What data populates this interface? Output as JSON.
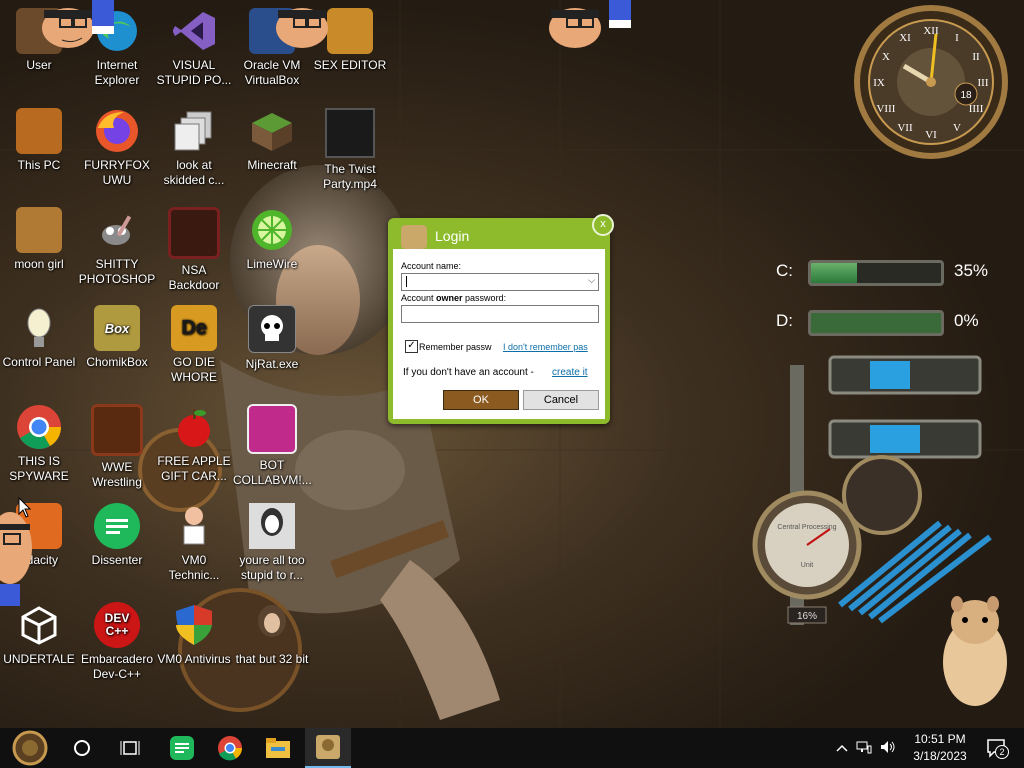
{
  "desktop_icons": [
    {
      "label": "User",
      "icon": "user-icon",
      "color": "#6a4a2a"
    },
    {
      "label": "Internet Explorer",
      "icon": "edge-icon",
      "color": "#1e8fcf"
    },
    {
      "label": "VISUAL STUPID PO...",
      "icon": "visual-studio-icon",
      "color": "#6b3fa0"
    },
    {
      "label": "Oracle VM VirtualBox",
      "icon": "virtualbox-icon",
      "color": "#2a4e8c"
    },
    {
      "label": "SEX EDITOR",
      "icon": "hex-editor-icon",
      "color": "#c98a2a"
    },
    {
      "label": "This PC",
      "icon": "this-pc-icon",
      "color": "#b86b20"
    },
    {
      "label": "FURRYFOX UWU",
      "icon": "firefox-icon",
      "color": "#e8562a"
    },
    {
      "label": "look at skidded c...",
      "icon": "files-icon",
      "color": "#9a9a9a"
    },
    {
      "label": "Minecraft",
      "icon": "minecraft-icon",
      "color": "#5b7a35"
    },
    {
      "label": "The Twist Party.mp4",
      "icon": "video-icon",
      "color": "#2a2a2a"
    },
    {
      "label": "moon girl",
      "icon": "folder-icon",
      "color": "#b07a35"
    },
    {
      "label": "SHITTY PHOTOSHOP",
      "icon": "gimp-icon",
      "color": "#777777"
    },
    {
      "label": "NSA Backdoor",
      "icon": "backdoor-icon",
      "color": "#7a2020"
    },
    {
      "label": "LimeWire",
      "icon": "limewire-icon",
      "color": "#4fb52a"
    },
    {
      "label": "Control Panel",
      "icon": "lamp-icon",
      "color": "#8a8a8a"
    },
    {
      "label": "ChomikBox",
      "icon": "chomikbox-icon",
      "color": "#b09a40"
    },
    {
      "label": "GO DIE WHORE",
      "icon": "de-icon",
      "color": "#d89a20"
    },
    {
      "label": "NjRat.exe",
      "icon": "skull-icon",
      "color": "#444444"
    },
    {
      "label": "THIS IS SPYWARE",
      "icon": "chrome-icon",
      "color": "#2b78d8"
    },
    {
      "label": "WWE Wrestling",
      "icon": "tv-icon",
      "color": "#8a3a1a"
    },
    {
      "label": "FREE APPLE GIFT CAR...",
      "icon": "apple-icon",
      "color": "#cc1010"
    },
    {
      "label": "BOT COLLABVM!...",
      "icon": "bot-icon",
      "color": "#c02a8a"
    },
    {
      "label": "udacity",
      "icon": "audacity-icon",
      "color": "#e06a20"
    },
    {
      "label": "Dissenter",
      "icon": "dissenter-icon",
      "color": "#1fb85a"
    },
    {
      "label": "VM0 Technic...",
      "icon": "vm0-icon",
      "color": "#bfa680"
    },
    {
      "label": "youre all too stupid to r...",
      "icon": "portrait-icon",
      "color": "#dddddd"
    },
    {
      "label": "UNDERTALE",
      "icon": "unity-icon",
      "color": "#333333"
    },
    {
      "label": "Embarcadero Dev-C++",
      "icon": "devcpp-icon",
      "color": "#cc1515"
    },
    {
      "label": "VM0 Antivirus",
      "icon": "shield-icon",
      "color": "#2a6ad0"
    },
    {
      "label": "that but 32 bit",
      "icon": "portrait2-icon",
      "color": "#5a4430"
    }
  ],
  "icon_text": {
    "devcpp": "DEV C++",
    "de": "De",
    "box": "Box"
  },
  "dialog": {
    "title": "Login",
    "close": "x",
    "account_name_label": "Account name:",
    "owner_password_label_pre": "Account ",
    "owner_password_label_bold": "owner",
    "owner_password_label_post": " password:",
    "remember_label": "Remember passw",
    "forgot_link": "I don't remember pas",
    "no_account_text": "If you don't have an account - ",
    "create_link": "create it",
    "ok_label": "OK",
    "cancel_label": "Cancel",
    "checkbox_mark": "✓",
    "dropdown_arrow": "⌵",
    "accent": "#8dbb2c"
  },
  "widgets": {
    "clock_numerals": [
      "XII",
      "I",
      "II",
      "III",
      "IIII",
      "V",
      "VI",
      "VII",
      "VIII",
      "IX",
      "X",
      "XI"
    ],
    "clock_date": "18",
    "drive_c_label": "C:",
    "drive_c_percent": "35%",
    "drive_c_fill": 0.35,
    "drive_d_label": "D:",
    "drive_d_percent": "0%",
    "drive_d_fill": 0.0,
    "cpu_percent": "16%",
    "gauge_text_top": "Central Processing",
    "gauge_text_bottom": "Unit"
  },
  "taskbar": {
    "time": "10:51 PM",
    "date": "3/18/2023",
    "notification_count": "2",
    "pinned": [
      "start-icon",
      "cortana-icon",
      "task-view-icon",
      "dissenter-icon",
      "chrome-icon",
      "file-explorer-icon",
      "chomikbox-icon"
    ]
  }
}
